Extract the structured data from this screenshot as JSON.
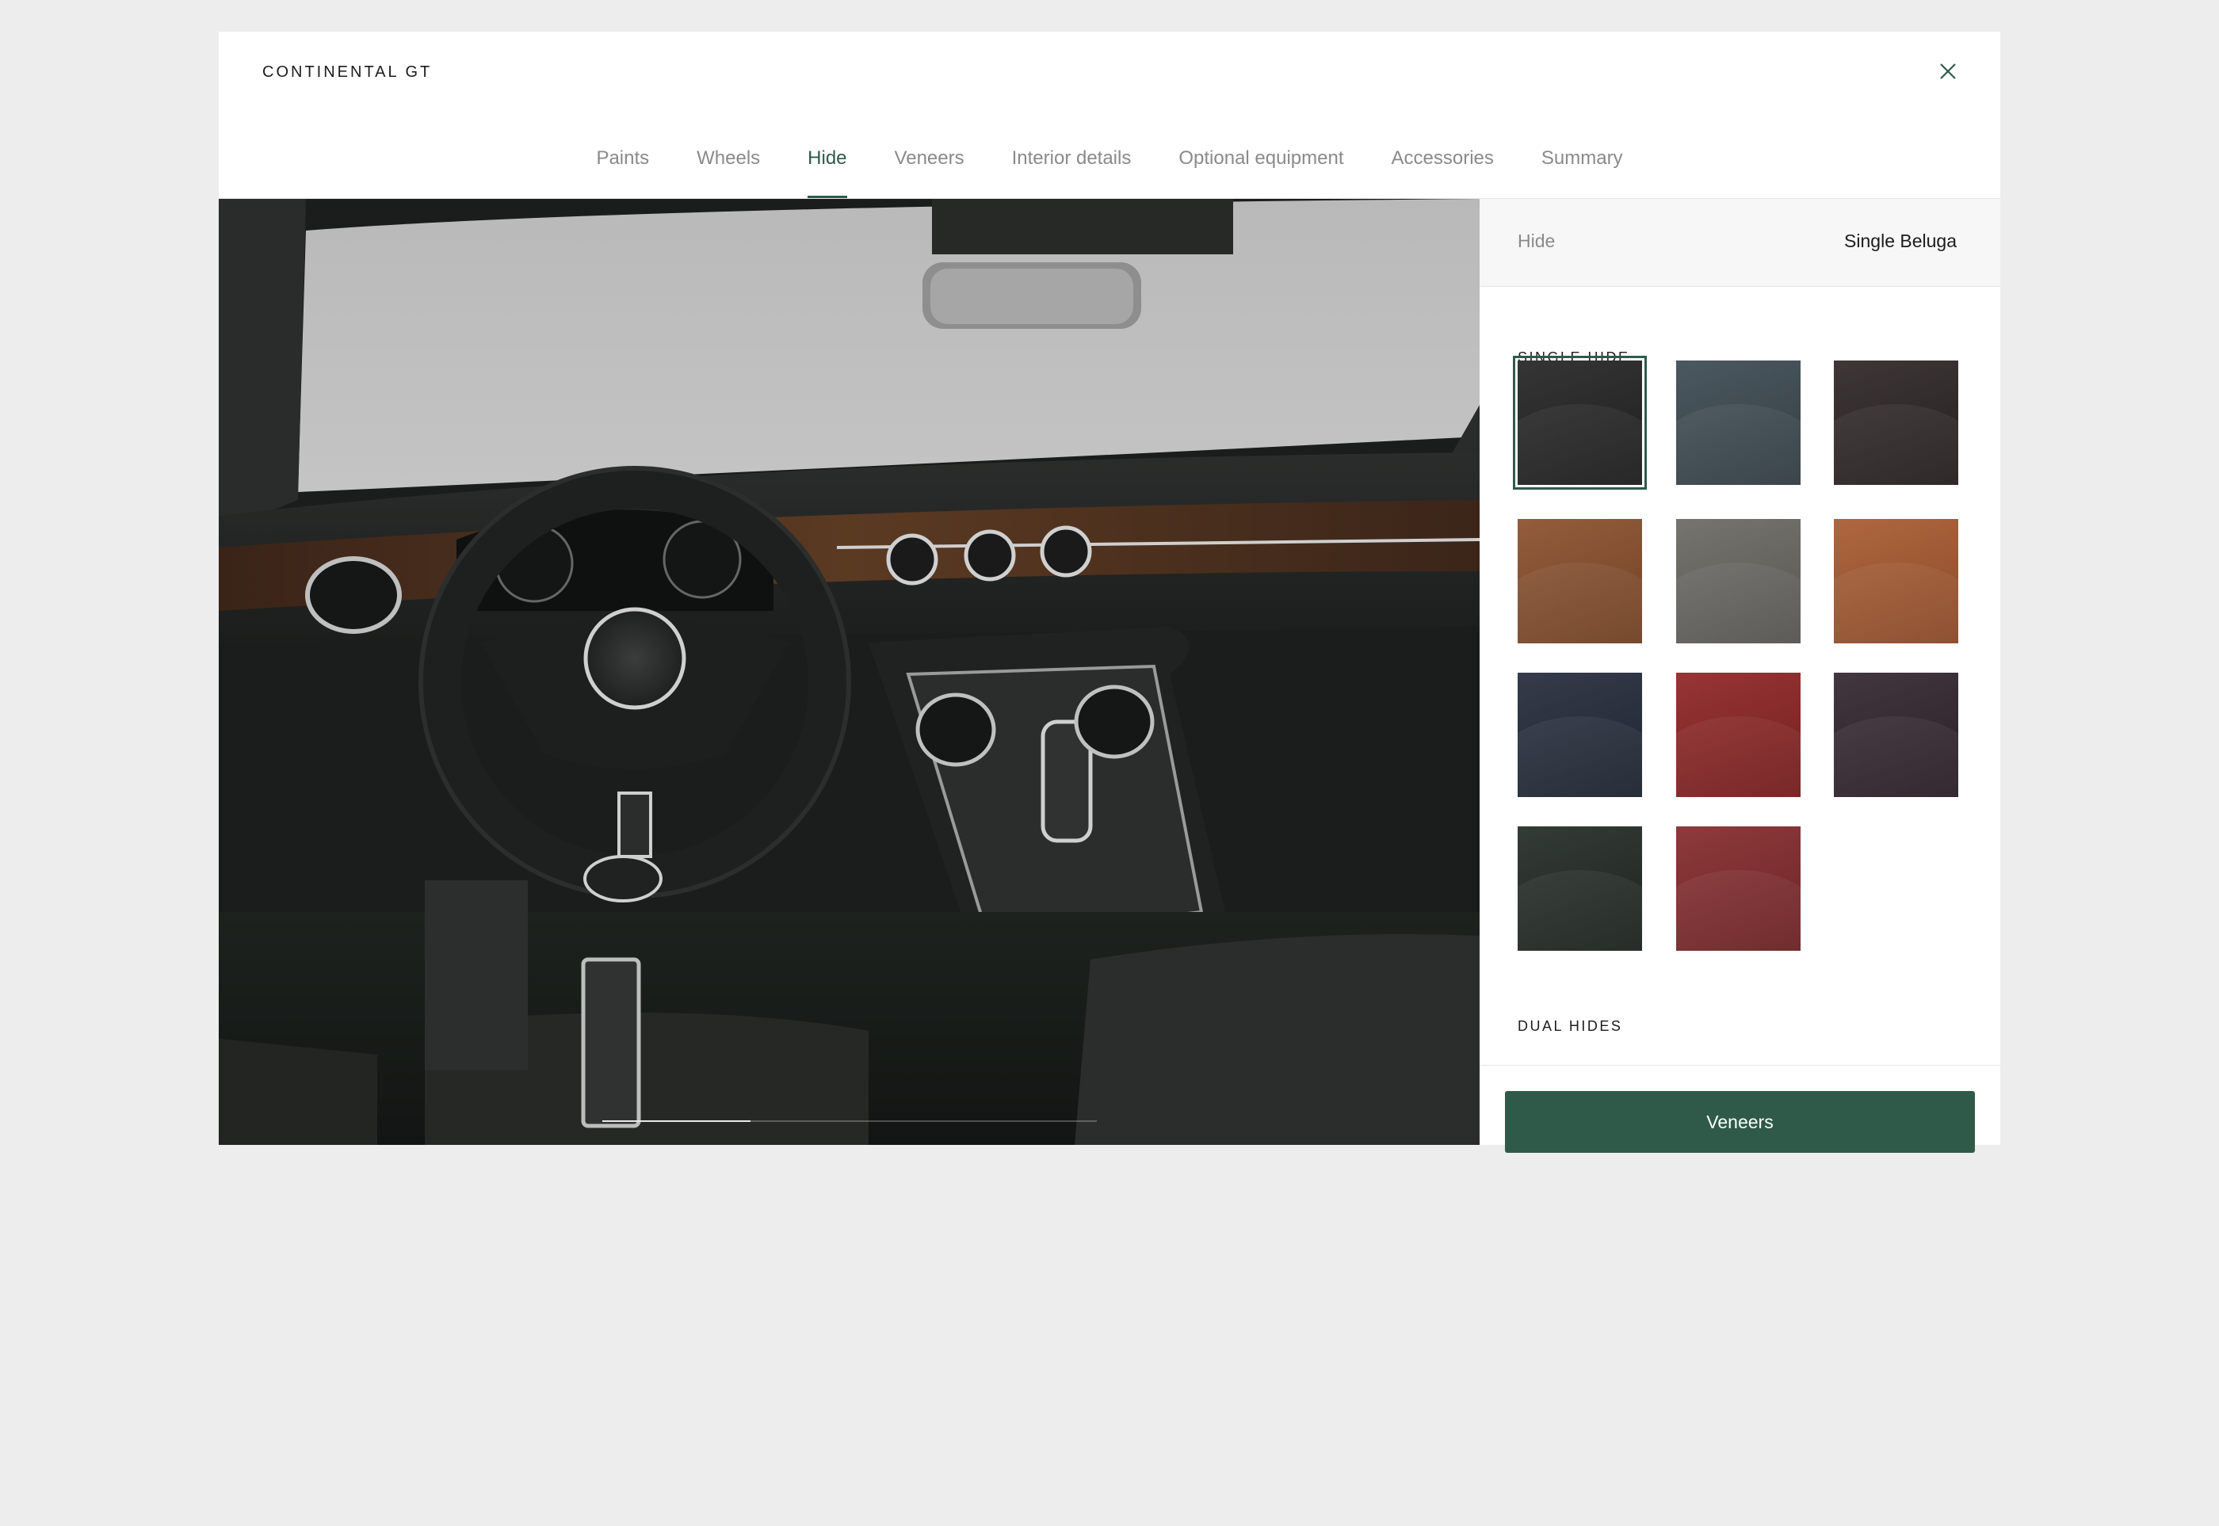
{
  "header": {
    "brand": "CONTINENTAL GT",
    "close_icon": "close-icon"
  },
  "tabs": [
    {
      "label": "Paints",
      "active": false
    },
    {
      "label": "Wheels",
      "active": false
    },
    {
      "label": "Hide",
      "active": true
    },
    {
      "label": "Veneers",
      "active": false
    },
    {
      "label": "Interior details",
      "active": false
    },
    {
      "label": "Optional equipment",
      "active": false
    },
    {
      "label": "Accessories",
      "active": false
    },
    {
      "label": "Summary",
      "active": false
    }
  ],
  "viewer": {
    "image": "interior-cockpit-view",
    "progress": 0.3
  },
  "panel": {
    "header_label": "Hide",
    "header_value": "Single Beluga",
    "single_hide_title": "SINGLE HIDE",
    "dual_hides_title": "DUAL HIDES",
    "swatches": [
      {
        "color": "#242424",
        "selected": true
      },
      {
        "color": "#3d4a52",
        "selected": false
      },
      {
        "color": "#2e2626",
        "selected": false
      },
      {
        "color": "#8a4f2c",
        "selected": false
      },
      {
        "color": "#6a6862",
        "selected": false
      },
      {
        "color": "#a85a30",
        "selected": false
      },
      {
        "color": "#242b3a",
        "selected": false
      },
      {
        "color": "#8e2424",
        "selected": false
      },
      {
        "color": "#33262e",
        "selected": false
      },
      {
        "color": "#232b26",
        "selected": false
      },
      {
        "color": "#842a2c",
        "selected": false
      }
    ],
    "next_button": "Veneers"
  },
  "colors": {
    "accent": "#2f5a4a",
    "background": "#ededed"
  }
}
